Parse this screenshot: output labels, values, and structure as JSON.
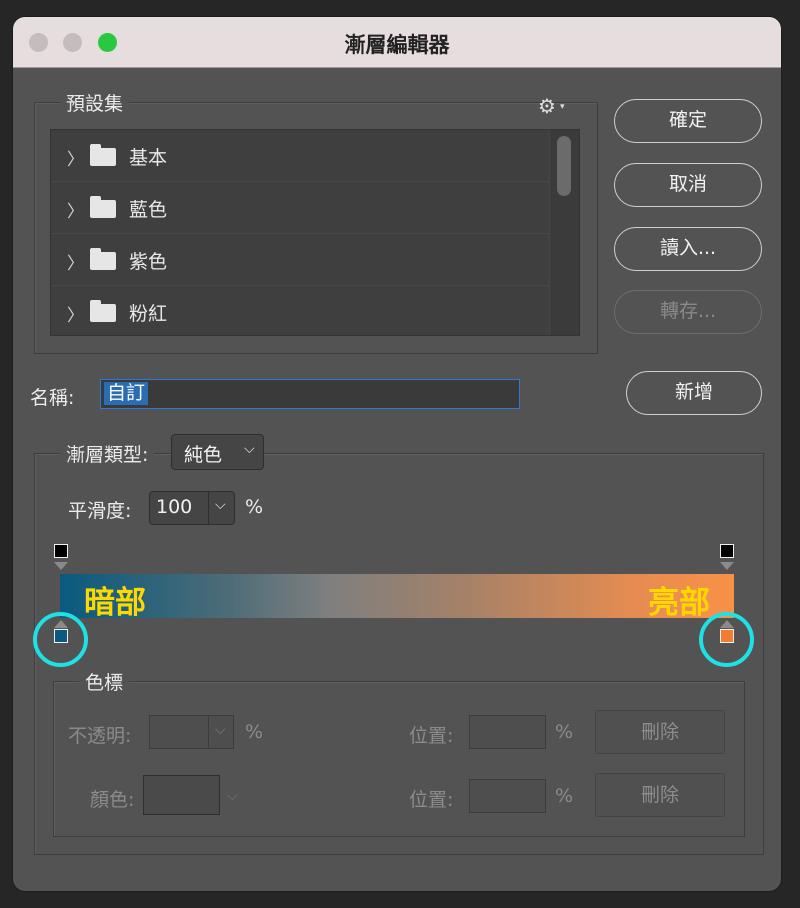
{
  "window": {
    "title": "漸層編輯器"
  },
  "presets": {
    "label": "預設集",
    "items": [
      {
        "label": "基本"
      },
      {
        "label": "藍色"
      },
      {
        "label": "紫色"
      },
      {
        "label": "粉紅"
      }
    ]
  },
  "buttons": {
    "ok": "確定",
    "cancel": "取消",
    "load": "讀入...",
    "save": "轉存...",
    "new": "新增"
  },
  "name": {
    "label": "名稱:",
    "value": "自訂"
  },
  "gradient": {
    "section_label": "漸層類型:",
    "type_value": "純色",
    "smoothness_label": "平滑度:",
    "smoothness_value": "100",
    "smoothness_unit": "%",
    "left_text": "暗部",
    "right_text": "亮部",
    "colors": {
      "start": "#0a5a7e",
      "end": "#f89148",
      "highlight": "#ffd800",
      "ring": "#1ee1e6"
    }
  },
  "stops": {
    "section_label": "色標",
    "opacity_label": "不透明:",
    "opacity_unit": "%",
    "color_label": "顏色:",
    "location_label": "位置:",
    "location_unit": "%",
    "location2_label": "位置:",
    "location2_unit": "%",
    "delete_label": "刪除",
    "delete2_label": "刪除"
  }
}
